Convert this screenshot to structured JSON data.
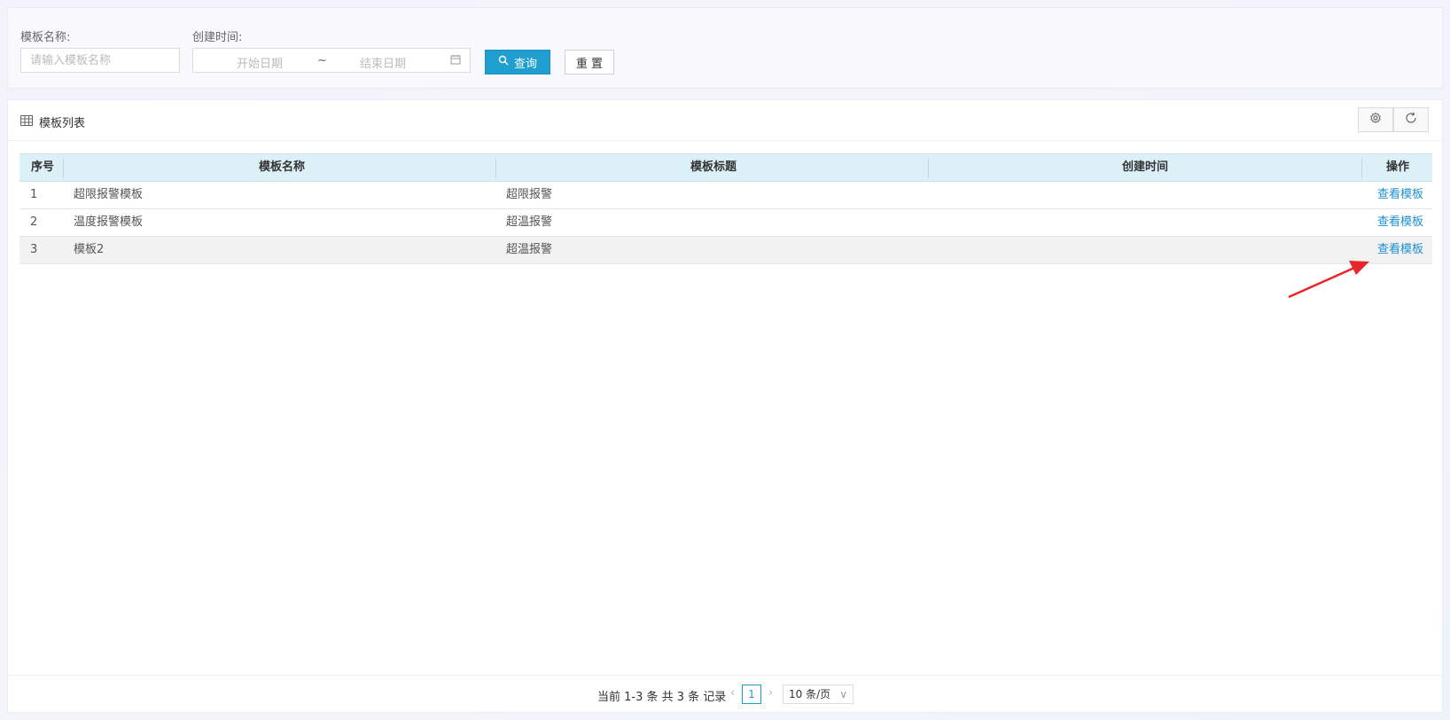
{
  "search": {
    "template_name_label": "模板名称:",
    "template_name_placeholder": "请输入模板名称",
    "create_time_label": "创建时间:",
    "start_date_placeholder": "开始日期",
    "range_separator": "~",
    "end_date_placeholder": "结束日期",
    "query_label": "查询",
    "reset_label": "重 置"
  },
  "panel": {
    "title": "模板列表"
  },
  "table": {
    "headers": [
      "序号",
      "模板名称",
      "模板标题",
      "创建时间",
      "操作"
    ],
    "rows": [
      {
        "index": "1",
        "name": "超限报警模板",
        "title": "超限报警",
        "created": "",
        "action": "查看模板"
      },
      {
        "index": "2",
        "name": "温度报警模板",
        "title": "超温报警",
        "created": "",
        "action": "查看模板"
      },
      {
        "index": "3",
        "name": "模板2",
        "title": "超温报警",
        "created": "",
        "action": "查看模板"
      }
    ]
  },
  "pager": {
    "summary": "当前 1-3 条 共 3 条 记录",
    "current_page": "1",
    "page_size": "10 条/页"
  },
  "colors": {
    "primary": "#1e9fd0",
    "link": "#1e8fd0",
    "header_bg": "#dcf0f8",
    "annotation_arrow": "#e8262b"
  }
}
